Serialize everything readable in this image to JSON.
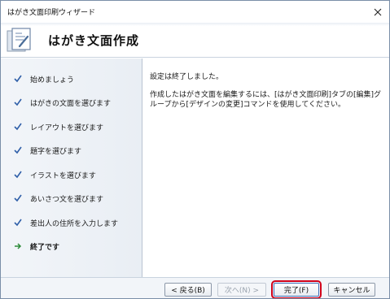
{
  "window": {
    "title": "はがき文面印刷ウィザード"
  },
  "header": {
    "title": "はがき文面作成"
  },
  "steps": [
    {
      "label": "始めましょう",
      "state": "done"
    },
    {
      "label": "はがきの文面を選びます",
      "state": "done"
    },
    {
      "label": "レイアウトを選びます",
      "state": "done"
    },
    {
      "label": "題字を選びます",
      "state": "done"
    },
    {
      "label": "イラストを選びます",
      "state": "done"
    },
    {
      "label": "あいさつ文を選びます",
      "state": "done"
    },
    {
      "label": "差出人の住所を入力します",
      "state": "done"
    },
    {
      "label": "終了です",
      "state": "current"
    }
  ],
  "content": {
    "line1": "設定は終了しました。",
    "line2a": "作成したはがき文面を編集するには、[はがき文面印刷]タブの[編集]グ",
    "line2b": "ループから[デザインの変更]コマンドを使用してください。"
  },
  "buttons": {
    "back": "< 戻る(B)",
    "next": "次へ(N) >",
    "finish": "完了(F)",
    "cancel": "キャンセル"
  },
  "colors": {
    "check": "#2f5fa8",
    "current_arrow": "#2e8b3a",
    "highlight": "#d0021b"
  }
}
